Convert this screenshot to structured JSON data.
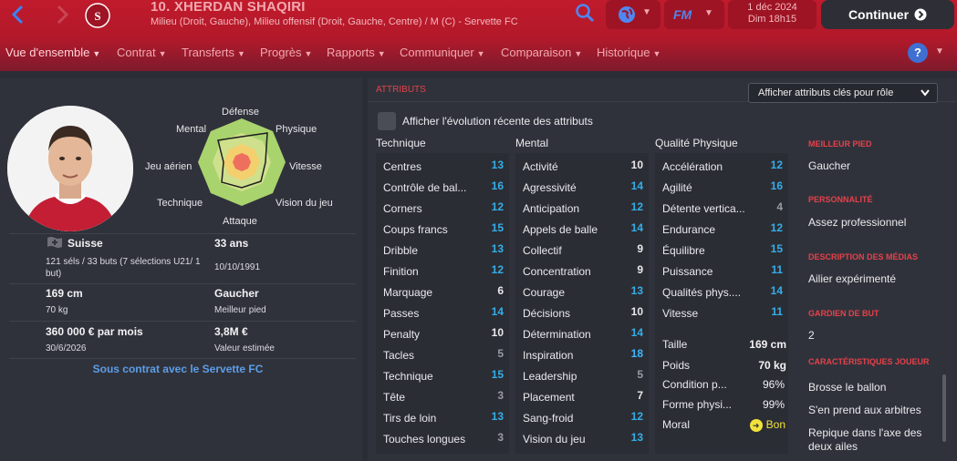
{
  "header": {
    "player_title": "10. XHERDAN SHAQIRI",
    "player_subtitle": "Milieu (Droit, Gauche), Milieu offensif (Droit, Gauche, Centre) / M (C) - Servette FC",
    "date": "1 déc 2024",
    "time": "Dim 18h15",
    "continue_label": "Continuer",
    "fm_label": "FM"
  },
  "tabs": [
    "Vue d'ensemble",
    "Contrat",
    "Transferts",
    "Progrès",
    "Rapports",
    "Communiquer",
    "Comparaison",
    "Historique"
  ],
  "radar": {
    "top": "Défense",
    "top_right": "Physique",
    "right": "Vitesse",
    "bottom_right": "Vision du jeu",
    "bottom": "Attaque",
    "bottom_left": "Technique",
    "left": "Jeu aérien",
    "top_left": "Mental"
  },
  "profile": {
    "nationality": "Suisse",
    "caps": "121 séls / 33 buts (7 sélections U21/ 1 but)",
    "age": "33 ans",
    "dob": "10/10/1991",
    "height": "169 cm",
    "weight": "70 kg",
    "foot": "Gaucher",
    "foot_label": "Meilleur pied",
    "wage": "360 000 € par mois",
    "contract_end": "30/6/2026",
    "value": "3,8M €",
    "value_label": "Valeur estimée",
    "contract_link": "Sous contrat avec le Servette FC"
  },
  "attributes": {
    "title": "ATTRIBUTS",
    "roles_dropdown": "Afficher attributs clés pour rôle",
    "recent_toggle": "Afficher l'évolution récente des attributs",
    "technique_head": "Technique",
    "mental_head": "Mental",
    "physical_head": "Qualité Physique",
    "technique": [
      {
        "name": "Centres",
        "value": "13",
        "tone": "blue"
      },
      {
        "name": "Contrôle de bal...",
        "value": "16",
        "tone": "blue"
      },
      {
        "name": "Corners",
        "value": "12",
        "tone": "blue"
      },
      {
        "name": "Coups francs",
        "value": "15",
        "tone": "blue"
      },
      {
        "name": "Dribble",
        "value": "13",
        "tone": "blue"
      },
      {
        "name": "Finition",
        "value": "12",
        "tone": "blue"
      },
      {
        "name": "Marquage",
        "value": "6",
        "tone": "white"
      },
      {
        "name": "Passes",
        "value": "14",
        "tone": "blue"
      },
      {
        "name": "Penalty",
        "value": "10",
        "tone": "white"
      },
      {
        "name": "Tacles",
        "value": "5",
        "tone": "grey"
      },
      {
        "name": "Technique",
        "value": "15",
        "tone": "blue"
      },
      {
        "name": "Tête",
        "value": "3",
        "tone": "grey"
      },
      {
        "name": "Tirs de loin",
        "value": "13",
        "tone": "blue"
      },
      {
        "name": "Touches longues",
        "value": "3",
        "tone": "grey"
      }
    ],
    "mental": [
      {
        "name": "Activité",
        "value": "10",
        "tone": "white"
      },
      {
        "name": "Agressivité",
        "value": "14",
        "tone": "blue"
      },
      {
        "name": "Anticipation",
        "value": "12",
        "tone": "blue"
      },
      {
        "name": "Appels de balle",
        "value": "14",
        "tone": "blue"
      },
      {
        "name": "Collectif",
        "value": "9",
        "tone": "white"
      },
      {
        "name": "Concentration",
        "value": "9",
        "tone": "white"
      },
      {
        "name": "Courage",
        "value": "13",
        "tone": "blue"
      },
      {
        "name": "Décisions",
        "value": "10",
        "tone": "white"
      },
      {
        "name": "Détermination",
        "value": "14",
        "tone": "blue"
      },
      {
        "name": "Inspiration",
        "value": "18",
        "tone": "bright"
      },
      {
        "name": "Leadership",
        "value": "5",
        "tone": "grey"
      },
      {
        "name": "Placement",
        "value": "7",
        "tone": "white"
      },
      {
        "name": "Sang-froid",
        "value": "12",
        "tone": "blue"
      },
      {
        "name": "Vision du jeu",
        "value": "13",
        "tone": "blue"
      }
    ],
    "physical": [
      {
        "name": "Accélération",
        "value": "12",
        "tone": "blue"
      },
      {
        "name": "Agilité",
        "value": "16",
        "tone": "blue"
      },
      {
        "name": "Détente vertica...",
        "value": "4",
        "tone": "grey"
      },
      {
        "name": "Endurance",
        "value": "12",
        "tone": "blue"
      },
      {
        "name": "Équilibre",
        "value": "15",
        "tone": "blue"
      },
      {
        "name": "Puissance",
        "value": "11",
        "tone": "blue"
      },
      {
        "name": "Qualités phys....",
        "value": "14",
        "tone": "blue"
      },
      {
        "name": "Vitesse",
        "value": "11",
        "tone": "blue"
      }
    ],
    "metrics": [
      {
        "label": "Taille",
        "value": "169 cm"
      },
      {
        "label": "Poids",
        "value": "70 kg"
      },
      {
        "label": "Condition p...",
        "value": "96%"
      },
      {
        "label": "Forme physi...",
        "value": "99%"
      },
      {
        "label": "Moral",
        "value": "Bon"
      }
    ]
  },
  "right_sidebar": [
    {
      "heading": "MEILLEUR PIED",
      "value": "Gaucher"
    },
    {
      "heading": "PERSONNALITÉ",
      "value": "Assez professionnel"
    },
    {
      "heading": "DESCRIPTION DES MÉDIAS",
      "value": "Ailier expérimenté"
    },
    {
      "heading": "GARDIEN DE BUT",
      "value": "2"
    },
    {
      "heading": "CARACTÉRISTIQUES JOUEUR",
      "value": "Brosse le ballon"
    }
  ],
  "traits_more": [
    "S'en prend aux arbitres",
    "Repique dans l'axe des deux ailes"
  ],
  "colors": {
    "header_red": "#c01b2c",
    "accent_red": "#e6414a",
    "value_blue": "#34aee8",
    "link_blue": "#5c9ee8"
  }
}
